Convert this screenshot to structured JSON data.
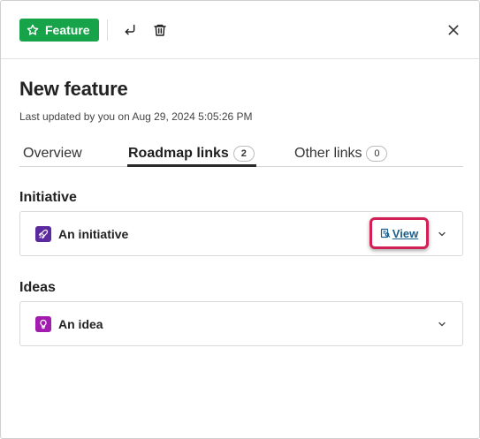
{
  "toolbar": {
    "feature_label": "Feature",
    "feature_color": "#17a34a"
  },
  "header": {
    "title": "New feature",
    "updated": "Last updated by you on Aug 29, 2024 5:05:26 PM"
  },
  "tabs": [
    {
      "label": "Overview"
    },
    {
      "label": "Roadmap links",
      "count": "2",
      "active": true
    },
    {
      "label": "Other links",
      "count": "0"
    }
  ],
  "sections": {
    "initiative": {
      "heading": "Initiative",
      "item_name": "An initiative",
      "icon": "rocket-icon",
      "icon_color": "#5b2a9e",
      "view_label": "View",
      "highlight_color": "#d21f56"
    },
    "ideas": {
      "heading": "Ideas",
      "item_name": "An idea",
      "icon": "lightbulb-icon",
      "icon_color": "#a21caf"
    }
  }
}
